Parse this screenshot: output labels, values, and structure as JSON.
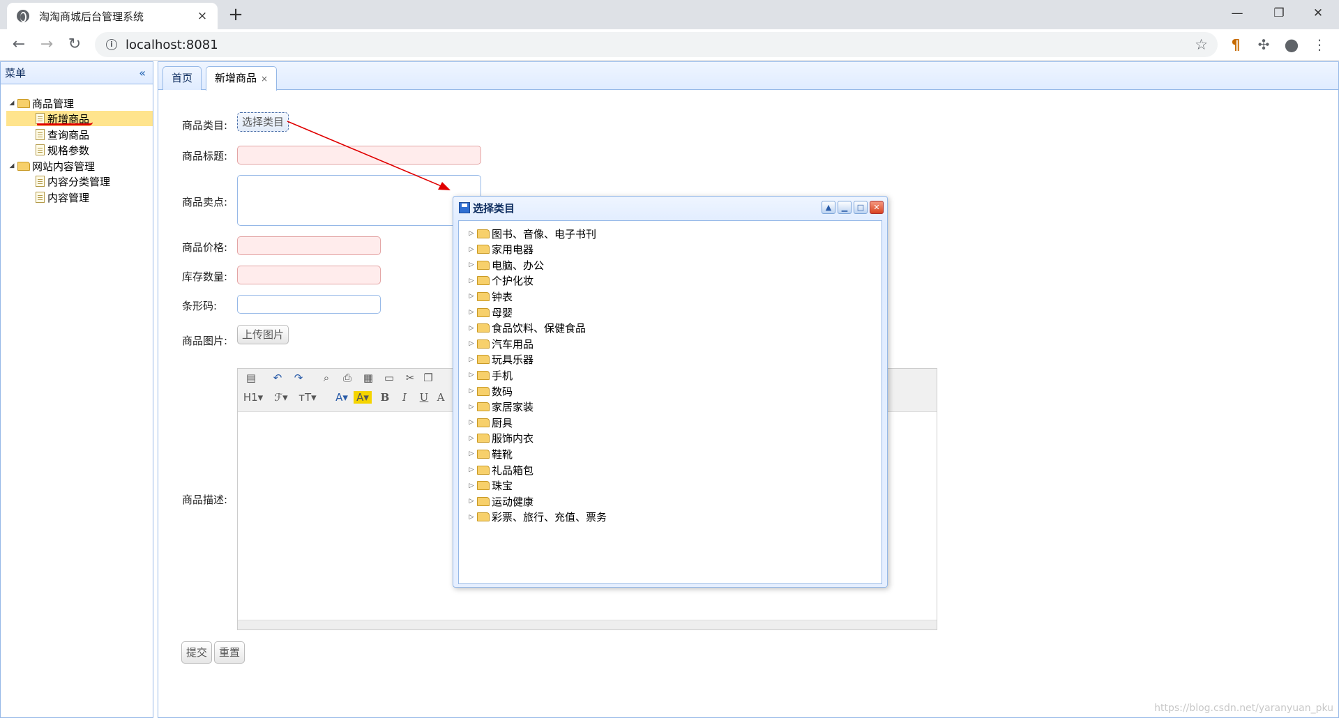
{
  "browser": {
    "tab_title": "淘淘商城后台管理系统",
    "tab_close": "×",
    "new_tab": "+",
    "url": "localhost:8081",
    "win_min": "—",
    "win_restore": "❐",
    "win_close": "✕"
  },
  "west": {
    "title": "菜单",
    "collapse_icon": "«",
    "tree": [
      {
        "label": "商品管理",
        "type": "folder",
        "level": 0
      },
      {
        "label": "新增商品",
        "type": "file",
        "level": 1,
        "selected": true
      },
      {
        "label": "查询商品",
        "type": "file",
        "level": 1
      },
      {
        "label": "规格参数",
        "type": "file",
        "level": 1
      },
      {
        "label": "网站内容管理",
        "type": "folder",
        "level": 0
      },
      {
        "label": "内容分类管理",
        "type": "file",
        "level": 1
      },
      {
        "label": "内容管理",
        "type": "file",
        "level": 1
      }
    ]
  },
  "center": {
    "tabs": [
      {
        "label": "首页"
      },
      {
        "label": "新增商品",
        "close": "×"
      }
    ]
  },
  "form": {
    "category_label": "商品类目:",
    "category_button": "选择类目",
    "title_label": "商品标题:",
    "sellpoint_label": "商品卖点:",
    "price_label": "商品价格:",
    "stock_label": "库存数量:",
    "barcode_label": "条形码:",
    "image_label": "商品图片:",
    "image_button": "上传图片",
    "desc_label": "商品描述:",
    "submit": "提交",
    "reset": "重置"
  },
  "editor": {
    "row2": [
      "H1▾",
      "ℱ▾",
      "тT▾",
      "A▾",
      "A▾",
      "B",
      "I",
      "U",
      "A"
    ]
  },
  "dialog": {
    "title": "选择类目",
    "items": [
      "图书、音像、电子书刊",
      "家用电器",
      "电脑、办公",
      "个护化妆",
      "钟表",
      "母婴",
      "食品饮料、保健食品",
      "汽车用品",
      "玩具乐器",
      "手机",
      "数码",
      "家居家装",
      "厨具",
      "服饰内衣",
      "鞋靴",
      "礼品箱包",
      "珠宝",
      "运动健康",
      "彩票、旅行、充值、票务"
    ]
  },
  "watermark": "https://blog.csdn.net/yaranyuan_pku"
}
